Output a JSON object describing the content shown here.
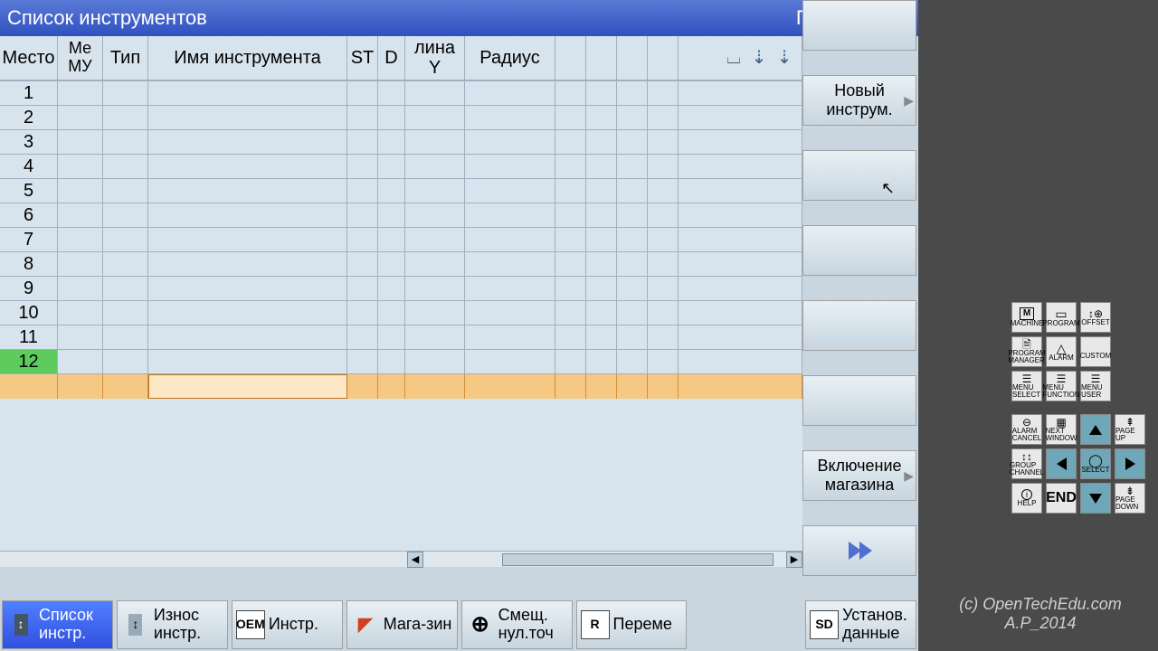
{
  "title_left": "Список инструментов",
  "title_right": "Память ЧПУ",
  "columns": {
    "mesto": "Место",
    "memu": "Ме МУ",
    "tip": "Тип",
    "name": "Имя инструмента",
    "st": "ST",
    "d": "D",
    "tinay": "лина Y",
    "radius": "Радиус"
  },
  "rows": [
    "1",
    "2",
    "3",
    "4",
    "5",
    "6",
    "7",
    "8",
    "9",
    "10",
    "11",
    "12"
  ],
  "selected_row_index": 11,
  "softkeys_right": {
    "sk1": "",
    "sk2": "Новый инструм.",
    "sk3": "",
    "sk4": "",
    "sk5": "",
    "sk6": "",
    "sk7": "Включение магазина",
    "sk8": ""
  },
  "softkeys_bottom": {
    "b1": "Список инстр.",
    "b2": "Износ инстр.",
    "b3": "Инстр.",
    "b3_icon": "OEM",
    "b4": "Мага-зин",
    "b5": "Смещ. нул.точ",
    "b6": "Переме",
    "b6_icon": "R",
    "b7": "Установ. данные",
    "b7_icon": "SD"
  },
  "keypad": {
    "r1": [
      "MACHINE",
      "PROGRAM",
      "OFFSET"
    ],
    "r1_box": [
      "M",
      "",
      ""
    ],
    "r2": [
      "PROGRAM MANAGER",
      "ALARM",
      "CUSTOM"
    ],
    "r3": [
      "MENU SELECT",
      "MENU FUNCTION",
      "MENU USER"
    ],
    "r4": [
      "ALARM CANCEL",
      "NEXT WINDOW",
      "",
      "PAGE UP"
    ],
    "r5": [
      "GROUP CHANNEL",
      "",
      "SELECT",
      ""
    ],
    "r6": [
      "HELP",
      "END",
      "",
      "PAGE DOWN"
    ]
  },
  "copyright": "(c) OpenTechEdu.com A.P_2014"
}
